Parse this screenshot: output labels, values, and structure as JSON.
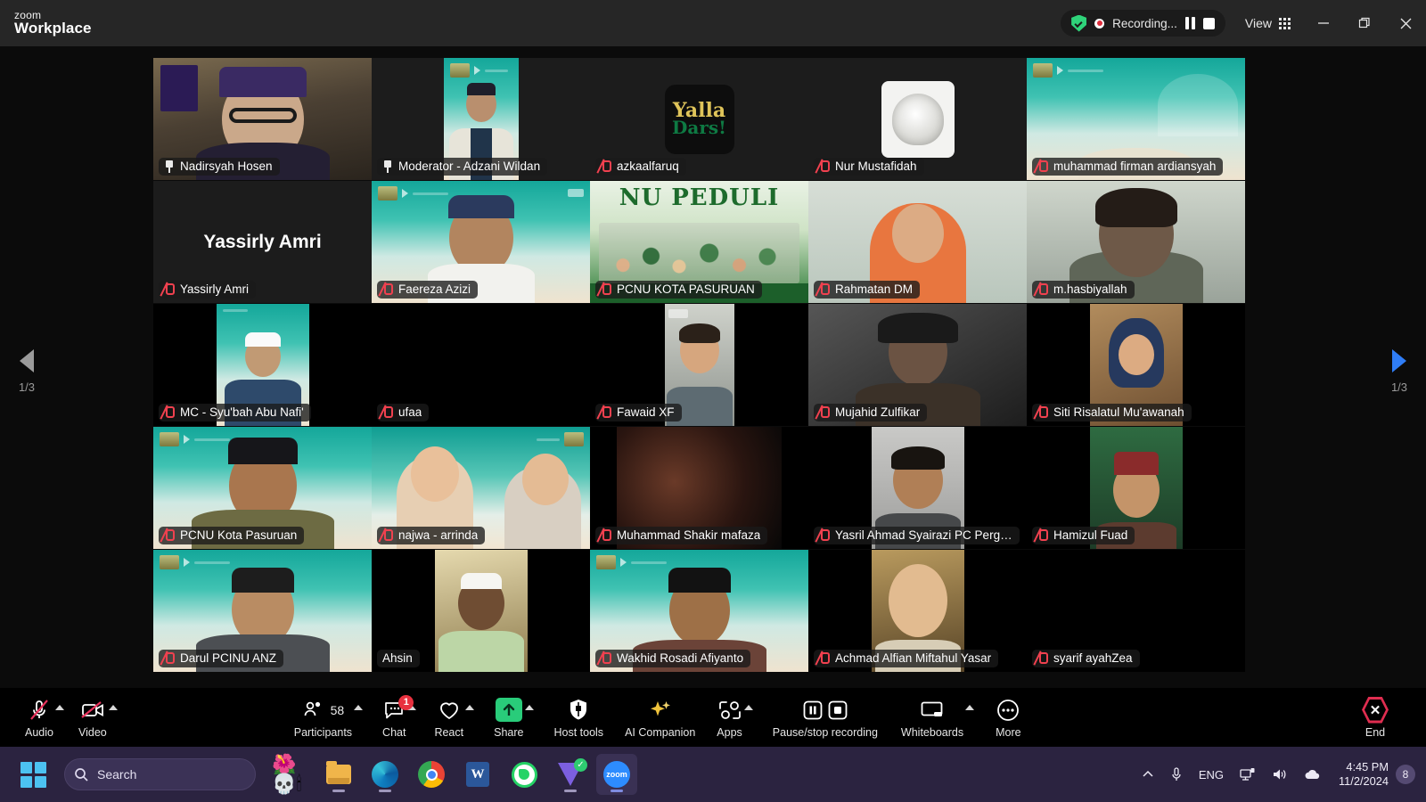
{
  "app": {
    "brand_line1": "zoom",
    "brand_line2": "Workplace"
  },
  "titlebar": {
    "security_icon": "shield-check-icon",
    "recording_label": "Recording...",
    "pause_recording_icon": "pause-icon",
    "stop_recording_icon": "stop-icon",
    "view_label": "View",
    "view_icon": "grid-icon",
    "minimize_icon": "minimize-icon",
    "restore_icon": "restore-icon",
    "close_icon": "close-icon"
  },
  "pagination": {
    "prev_icon": "chevron-left-icon",
    "next_icon": "chevron-right-icon",
    "left_label": "1/3",
    "right_label": "1/3"
  },
  "participants": [
    {
      "name": "Nadirsyah Hosen",
      "status": "pinned",
      "active": true,
      "bg": "bg-room"
    },
    {
      "name": "Moderator - Adzani Wildan",
      "status": "pinned",
      "active": false,
      "bg": "bg-dark"
    },
    {
      "name": "azkaalfaruq",
      "status": "muted",
      "active": false,
      "bg": "bg-dark"
    },
    {
      "name": "Nur Mustafidah",
      "status": "muted",
      "active": false,
      "bg": "bg-dark"
    },
    {
      "name": "muhammad firman ardiansyah",
      "status": "muted",
      "active": false,
      "bg": "bg-teal"
    },
    {
      "name": "Yassirly Amri",
      "status": "muted",
      "active": false,
      "bg": "bg-dark",
      "display_text": "Yassirly Amri"
    },
    {
      "name": "Faereza Azizi",
      "status": "muted",
      "active": false,
      "bg": "bg-teal"
    },
    {
      "name": "PCNU KOTA PASURUAN",
      "status": "muted",
      "active": false,
      "bg": "bg-dark"
    },
    {
      "name": "Rahmatan DM",
      "status": "muted",
      "active": false,
      "bg": "bg-wall"
    },
    {
      "name": "m.hasbiyallah",
      "status": "muted",
      "active": false,
      "bg": "bg-wall"
    },
    {
      "name": "MC - Syu'bah Abu Nafi'",
      "status": "muted",
      "active": false,
      "bg": "bg-teal"
    },
    {
      "name": "ufaa",
      "status": "muted",
      "active": false,
      "bg": "bg-black"
    },
    {
      "name": "Fawaid XF",
      "status": "muted",
      "active": false,
      "bg": "bg-wall"
    },
    {
      "name": "Mujahid Zulfikar",
      "status": "muted",
      "active": false,
      "bg": "bg-studio"
    },
    {
      "name": "Siti Risalatul Mu'awanah",
      "status": "muted",
      "active": false,
      "bg": "bg-room"
    },
    {
      "name": "PCNU Kota Pasuruan",
      "status": "muted",
      "active": false,
      "bg": "bg-teal"
    },
    {
      "name": "najwa - arrinda",
      "status": "muted",
      "active": false,
      "bg": "bg-teal2"
    },
    {
      "name": "Muhammad Shakir mafaza",
      "status": "muted",
      "active": false,
      "bg": "bg-black"
    },
    {
      "name": "Yasril Ahmad Syairazi PC Pergunu Ko...",
      "status": "muted",
      "active": false,
      "bg": "bg-wall"
    },
    {
      "name": "Hamizul Fuad",
      "status": "muted",
      "active": false,
      "bg": "bg-room"
    },
    {
      "name": "Darul PCINU ANZ",
      "status": "muted",
      "active": false,
      "bg": "bg-teal"
    },
    {
      "name": "Ahsin",
      "status": "none",
      "active": false,
      "bg": "bg-room"
    },
    {
      "name": "Wakhid Rosadi Afiyanto",
      "status": "muted",
      "active": false,
      "bg": "bg-teal"
    },
    {
      "name": "Achmad Alfian Miftahul Yasar",
      "status": "muted",
      "active": false,
      "bg": "bg-room"
    },
    {
      "name": "syarif ayahZea",
      "status": "muted",
      "active": false,
      "bg": "bg-black"
    }
  ],
  "toolbar": {
    "audio": {
      "label": "Audio",
      "icon": "microphone-muted-icon",
      "has_caret": true
    },
    "video": {
      "label": "Video",
      "icon": "camera-muted-icon",
      "has_caret": true
    },
    "participants": {
      "label": "Participants",
      "icon": "people-icon",
      "count": "58",
      "has_caret": true
    },
    "chat": {
      "label": "Chat",
      "icon": "chat-bubble-icon",
      "badge": "1",
      "has_caret": true
    },
    "react": {
      "label": "React",
      "icon": "heart-icon",
      "has_caret": true
    },
    "share": {
      "label": "Share",
      "icon": "share-screen-icon",
      "has_caret": true
    },
    "host_tools": {
      "label": "Host tools",
      "icon": "shield-icon",
      "has_caret": false
    },
    "ai_companion": {
      "label": "AI Companion",
      "icon": "sparkle-icon",
      "has_caret": false
    },
    "apps": {
      "label": "Apps",
      "icon": "apps-icon",
      "has_caret": true
    },
    "recording": {
      "label": "Pause/stop recording",
      "icon": "pause-stop-icon",
      "has_caret": false
    },
    "whiteboards": {
      "label": "Whiteboards",
      "icon": "whiteboard-icon",
      "has_caret": true
    },
    "more": {
      "label": "More",
      "icon": "ellipsis-icon",
      "has_caret": false
    },
    "end": {
      "label": "End",
      "icon": "end-call-icon",
      "has_caret": false
    }
  },
  "taskbar": {
    "start_icon": "windows-start-icon",
    "search_icon": "search-icon",
    "search_placeholder": "Search",
    "apps": [
      {
        "name": "decoration-emoji-icon",
        "running": false
      },
      {
        "name": "file-explorer-icon",
        "running": true
      },
      {
        "name": "edge-icon",
        "running": true
      },
      {
        "name": "chrome-icon",
        "running": false
      },
      {
        "name": "word-icon",
        "running": false
      },
      {
        "name": "whatsapp-icon",
        "running": false
      },
      {
        "name": "app-checkmark-icon",
        "running": true
      },
      {
        "name": "zoom-icon",
        "running": true
      }
    ],
    "tray": {
      "overflow_icon": "chevron-up-icon",
      "mic_icon": "microphone-icon",
      "language": "ENG",
      "network_icon": "network-icon",
      "volume_icon": "volume-icon",
      "weather_icon": "cloud-icon",
      "time": "4:45 PM",
      "date": "11/2/2024",
      "notification_count": "8"
    }
  },
  "colors": {
    "accent_green": "#39d67f",
    "record_red": "#e02d3c",
    "mute_red": "#f0414f",
    "share_green": "#29cc7a",
    "end_red": "#e02d50",
    "taskbar_bg": "#2b2340",
    "titlebar_bg": "#262626"
  }
}
